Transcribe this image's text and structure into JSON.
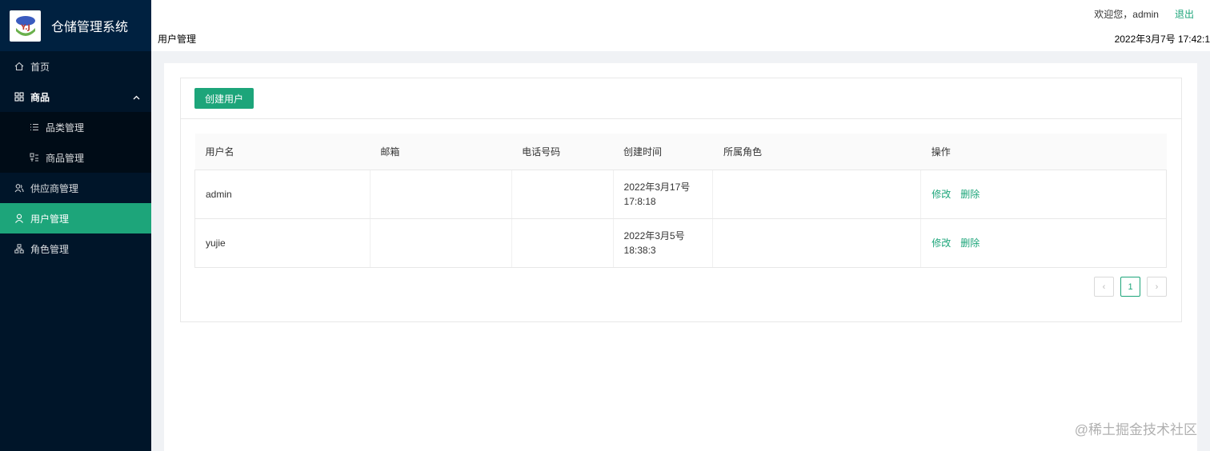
{
  "app": {
    "title": "仓储管理系统",
    "logo_text": "Y.J"
  },
  "sidebar": {
    "items": [
      {
        "label": "首页",
        "icon": "home-icon"
      },
      {
        "label": "商品",
        "icon": "appstore-icon"
      },
      {
        "label": "品类管理",
        "icon": "bars-icon"
      },
      {
        "label": "商品管理",
        "icon": "tool-icon"
      },
      {
        "label": "供应商管理",
        "icon": "team-icon"
      },
      {
        "label": "用户管理",
        "icon": "user-icon"
      },
      {
        "label": "角色管理",
        "icon": "safety-icon"
      }
    ],
    "active": "用户管理"
  },
  "header": {
    "welcome": "欢迎您，admin",
    "logout": "退出",
    "page_title": "用户管理",
    "time": "2022年3月7号 17:42:1"
  },
  "toolbar": {
    "create_label": "创建用户"
  },
  "table": {
    "headers": [
      "用户名",
      "邮箱",
      "电话号码",
      "创建时间",
      "所属角色",
      "操作"
    ],
    "rows": [
      {
        "username": "admin",
        "email": "",
        "phone": "",
        "created_line1": "2022年3月17号",
        "created_line2": "17:8:18",
        "role": "",
        "edit": "修改",
        "delete": "删除"
      },
      {
        "username": "yujie",
        "email": "",
        "phone": "",
        "created_line1": "2022年3月5号",
        "created_line2": "18:38:3",
        "role": "",
        "edit": "修改",
        "delete": "删除"
      }
    ]
  },
  "pagination": {
    "current": "1",
    "prev": "‹",
    "next": "›"
  },
  "watermark": "@稀土掘金技术社区",
  "colors": {
    "accent": "#1da57a",
    "sidebar_bg": "#001529"
  }
}
